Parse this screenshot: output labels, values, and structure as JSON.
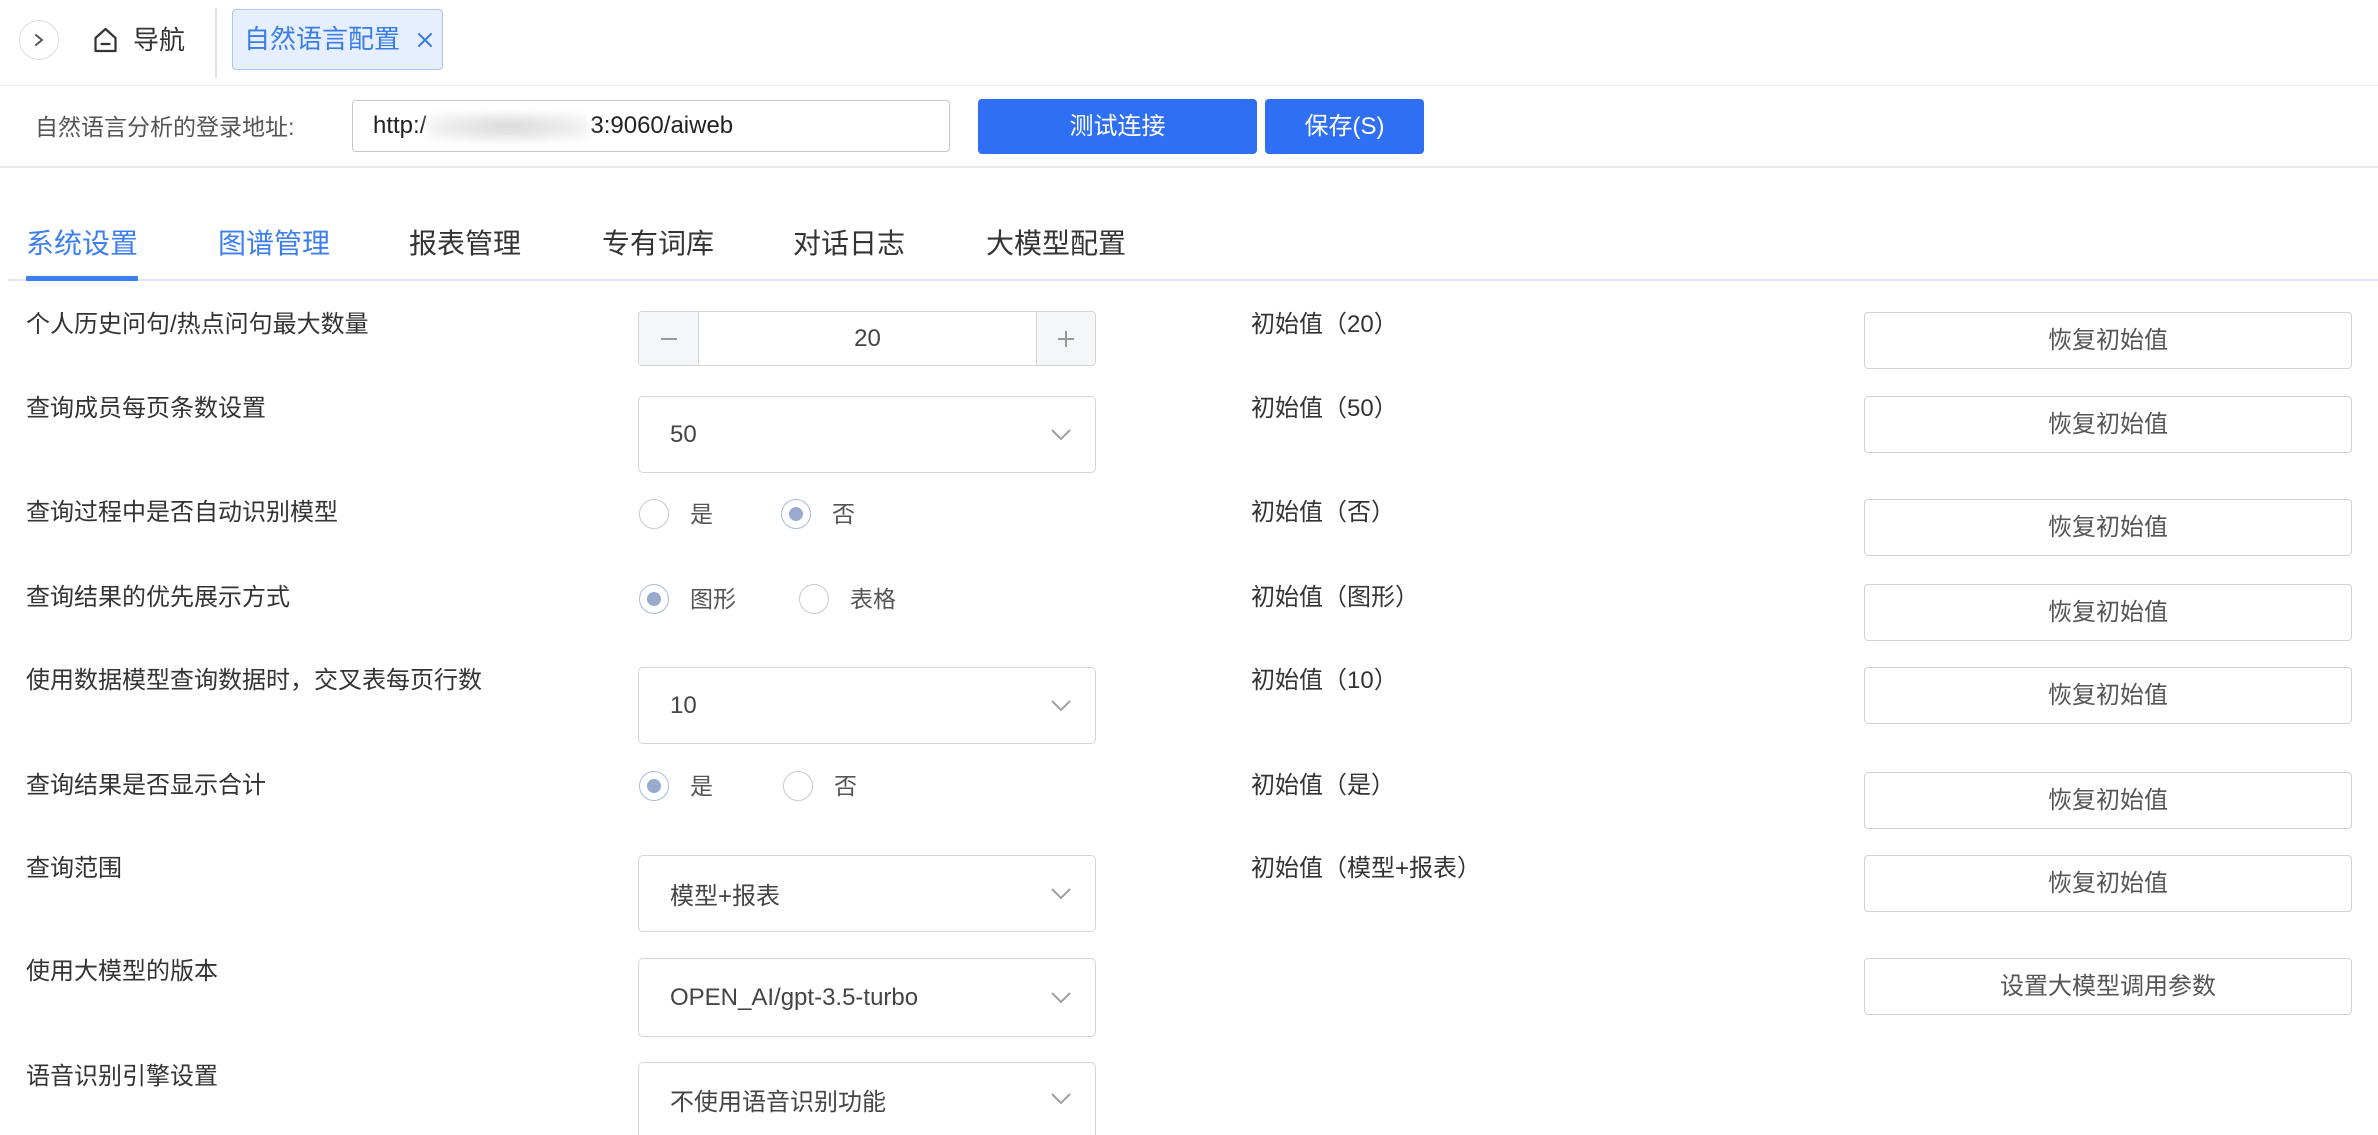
{
  "top_nav": {
    "collapse_icon": "chevron-right-icon",
    "home_icon": "home-icon",
    "home_label": "导航",
    "active_tab_label": "自然语言配置",
    "close_icon": "close-icon"
  },
  "login": {
    "label": "自然语言分析的登录地址:",
    "url_prefix": "http:/",
    "url_suffix": "3:9060/aiweb",
    "test_button": "测试连接",
    "save_button": "保存(S)"
  },
  "tabs": [
    {
      "label": "系统设置",
      "state": "active"
    },
    {
      "label": "图谱管理",
      "state": "hover"
    },
    {
      "label": "报表管理",
      "state": ""
    },
    {
      "label": "专有词库",
      "state": ""
    },
    {
      "label": "对话日志",
      "state": ""
    },
    {
      "label": "大模型配置",
      "state": ""
    }
  ],
  "settings": {
    "rows": [
      {
        "label": "个人历史问句/热点问句最大数量",
        "control": "stepper",
        "value": "20",
        "minus_icon": "minus-icon",
        "plus_icon": "plus-icon",
        "initial": "初始值（20）",
        "button": "恢复初始值"
      },
      {
        "label": "查询成员每页条数设置",
        "control": "select",
        "value": "50",
        "initial": "初始值（50）",
        "button": "恢复初始值"
      },
      {
        "label": "查询过程中是否自动识别模型",
        "control": "radio",
        "options": [
          "是",
          "否"
        ],
        "selected": "否",
        "initial": "初始值（否）",
        "button": "恢复初始值"
      },
      {
        "label": "查询结果的优先展示方式",
        "control": "radio",
        "options": [
          "图形",
          "表格"
        ],
        "selected": "图形",
        "initial": "初始值（图形）",
        "button": "恢复初始值"
      },
      {
        "label": "使用数据模型查询数据时，交叉表每页行数",
        "control": "select",
        "value": "10",
        "initial": "初始值（10）",
        "button": "恢复初始值"
      },
      {
        "label": "查询结果是否显示合计",
        "control": "radio",
        "options": [
          "是",
          "否"
        ],
        "selected": "是",
        "initial": "初始值（是）",
        "button": "恢复初始值"
      },
      {
        "label": "查询范围",
        "control": "select",
        "value": "模型+报表",
        "initial": "初始值（模型+报表）",
        "button": "恢复初始值"
      },
      {
        "label": "使用大模型的版本",
        "control": "select",
        "value": "OPEN_AI/gpt-3.5-turbo",
        "button": "设置大模型调用参数"
      },
      {
        "label": "语音识别引擎设置",
        "control": "select",
        "value": "不使用语音识别功能"
      }
    ],
    "select_icon": "chevron-down-icon"
  },
  "colors": {
    "primary": "#2f6ff3",
    "tab_active": "#3d7ef0",
    "open_tab_text": "#3b7ce9",
    "open_tab_bg": "#e6efff",
    "radio_checked": "#98abcf"
  }
}
